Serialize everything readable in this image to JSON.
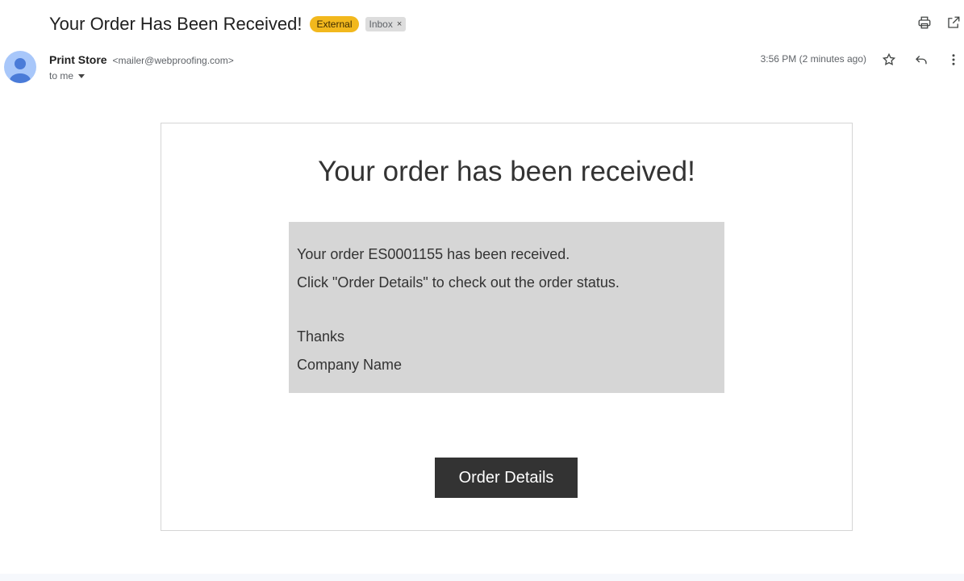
{
  "header": {
    "subject": "Your Order Has Been Received!",
    "labels": {
      "external": "External",
      "inbox": "Inbox",
      "remove_symbol": "×"
    }
  },
  "sender": {
    "name": "Print Store",
    "email": "<mailer@webproofing.com>",
    "recipient": "to me",
    "time": "3:56 PM (2 minutes ago)"
  },
  "icons": {
    "print": "print-icon",
    "open_new_window": "open-in-new-window-icon",
    "star": "star-icon",
    "reply": "reply-icon",
    "more": "more-vertical-icon"
  },
  "email": {
    "heading": "Your order has been received!",
    "lines": [
      "Your order ES0001155 has been received.",
      "Click \"Order Details\" to check out the order status.",
      "Thanks",
      "Company Name"
    ],
    "button_label": "Order Details"
  },
  "colors": {
    "external_badge": "#f2b81d",
    "message_box": "#d6d6d6",
    "button": "#333333",
    "avatar": "#a8c7fa"
  }
}
